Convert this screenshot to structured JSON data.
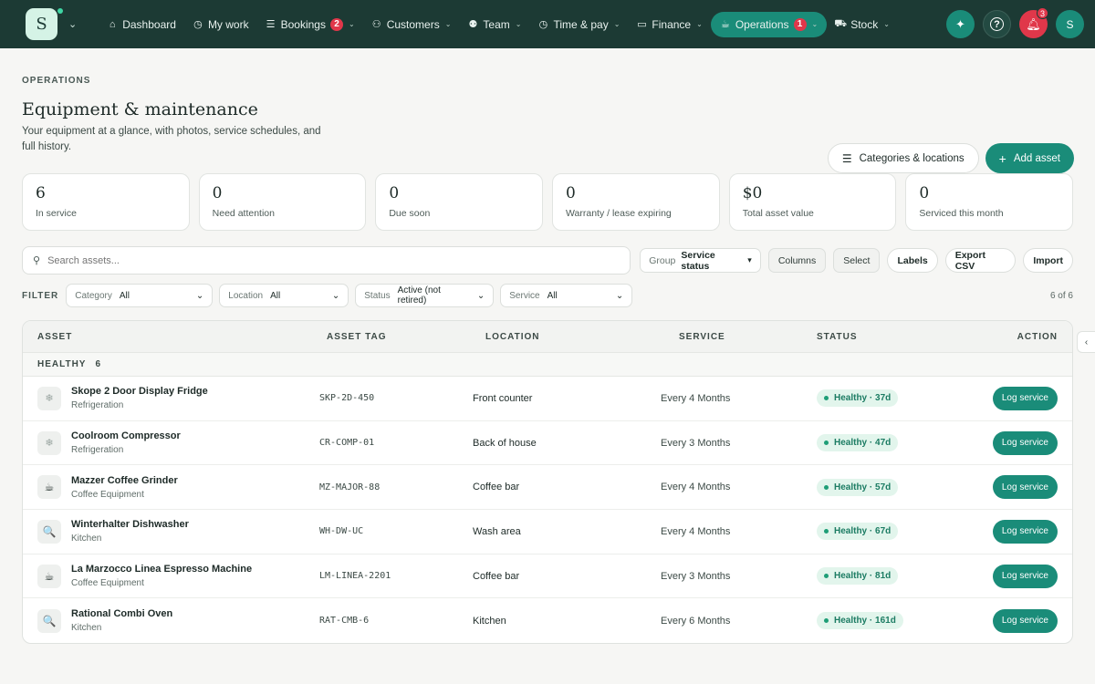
{
  "nav": {
    "logo_letter": "S",
    "items": [
      {
        "label": "Dashboard",
        "icon": "home-icon",
        "glyph": "⌂"
      },
      {
        "label": "My work",
        "icon": "clock-icon",
        "glyph": "◷"
      },
      {
        "label": "Bookings",
        "icon": "list-icon",
        "glyph": "☰",
        "badge": "2",
        "chevron": true
      },
      {
        "label": "Customers",
        "icon": "users-icon",
        "glyph": "⚇",
        "chevron": true
      },
      {
        "label": "Team",
        "icon": "team-icon",
        "glyph": "⚉",
        "chevron": true
      },
      {
        "label": "Time & pay",
        "icon": "clock-icon",
        "glyph": "◷",
        "chevron": true
      },
      {
        "label": "Finance",
        "icon": "card-icon",
        "glyph": "▭",
        "chevron": true
      },
      {
        "label": "Operations",
        "icon": "cup-icon",
        "glyph": "☕",
        "badge": "1",
        "chevron": true,
        "active": true
      },
      {
        "label": "Stock",
        "icon": "cart-icon",
        "glyph": "⛟",
        "chevron": true
      }
    ],
    "notification_count": "3",
    "avatar": "S"
  },
  "header": {
    "eyebrow": "OPERATIONS",
    "title": "Equipment & maintenance",
    "subtitle": "Your equipment at a glance, with photos, service schedules, and full history.",
    "categories_button": "Categories & locations",
    "add_button": "Add asset"
  },
  "stats": [
    {
      "value": "6",
      "label": "In service"
    },
    {
      "value": "0",
      "label": "Need attention"
    },
    {
      "value": "0",
      "label": "Due soon"
    },
    {
      "value": "0",
      "label": "Warranty / lease expiring"
    },
    {
      "value": "$0",
      "label": "Total asset value"
    },
    {
      "value": "0",
      "label": "Serviced this month"
    }
  ],
  "toolbar": {
    "search_placeholder": "Search assets...",
    "group_label": "Group",
    "group_value": "Service status",
    "columns": "Columns",
    "select": "Select",
    "labels": "Labels",
    "export": "Export CSV",
    "import": "Import"
  },
  "filters": {
    "label": "FILTER",
    "category": {
      "label": "Category",
      "value": "All"
    },
    "location": {
      "label": "Location",
      "value": "All"
    },
    "status": {
      "label": "Status",
      "value": "Active (not retired)"
    },
    "service": {
      "label": "Service",
      "value": "All"
    },
    "count": "6 of 6"
  },
  "table": {
    "headers": {
      "asset": "ASSET",
      "tag": "ASSET TAG",
      "location": "LOCATION",
      "service": "SERVICE",
      "status": "STATUS",
      "action": "ACTION"
    },
    "group": {
      "label": "HEALTHY",
      "count": "6"
    },
    "rows": [
      {
        "name": "Skope 2 Door Display Fridge",
        "category": "Refrigeration",
        "tag": "SKP-2D-450",
        "location": "Front counter",
        "service": "Every 4 Months",
        "status": "Healthy · 37d",
        "action": "Log service",
        "thumb": "snowflake-icon",
        "glyph": "❄"
      },
      {
        "name": "Coolroom Compressor",
        "category": "Refrigeration",
        "tag": "CR-COMP-01",
        "location": "Back of house",
        "service": "Every 3 Months",
        "status": "Healthy · 47d",
        "action": "Log service",
        "thumb": "snowflake-icon",
        "glyph": "❄"
      },
      {
        "name": "Mazzer Coffee Grinder",
        "category": "Coffee Equipment",
        "tag": "MZ-MAJOR-88",
        "location": "Coffee bar",
        "service": "Every 4 Months",
        "status": "Healthy · 57d",
        "action": "Log service",
        "thumb": "coffee-icon",
        "glyph": "☕"
      },
      {
        "name": "Winterhalter Dishwasher",
        "category": "Kitchen",
        "tag": "WH-DW-UC",
        "location": "Wash area",
        "service": "Every 4 Months",
        "status": "Healthy · 67d",
        "action": "Log service",
        "thumb": "magnifier-icon",
        "glyph": "🔍"
      },
      {
        "name": "La Marzocco Linea Espresso Machine",
        "category": "Coffee Equipment",
        "tag": "LM-LINEA-2201",
        "location": "Coffee bar",
        "service": "Every 3 Months",
        "status": "Healthy · 81d",
        "action": "Log service",
        "thumb": "coffee-icon",
        "glyph": "☕"
      },
      {
        "name": "Rational Combi Oven",
        "category": "Kitchen",
        "tag": "RAT-CMB-6",
        "location": "Kitchen",
        "service": "Every 6 Months",
        "status": "Healthy · 161d",
        "action": "Log service",
        "thumb": "magnifier-icon",
        "glyph": "🔍"
      }
    ]
  },
  "colors": {
    "nav_bg": "#1c3a34",
    "accent": "#1a8c79",
    "danger": "#e0374a",
    "healthy_bg": "#e2f5ec"
  }
}
